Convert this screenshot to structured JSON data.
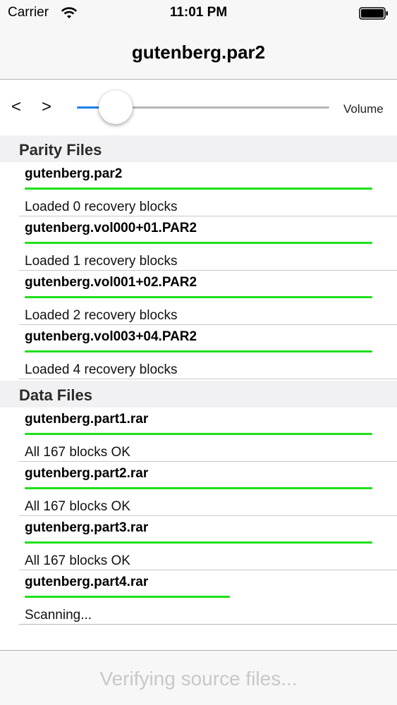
{
  "status_bar": {
    "carrier": "Carrier",
    "time": "11:01 PM",
    "battery_level": 1.0
  },
  "nav": {
    "title": "gutenberg.par2"
  },
  "controls": {
    "prev": "<",
    "next": ">",
    "volume_label": "Volume",
    "volume_level": 0.155
  },
  "colors": {
    "progress": "#1fe01a",
    "slider_accent": "#1a82e8"
  },
  "parity": {
    "header": "Parity Files",
    "files": [
      {
        "name": "gutenberg.par2",
        "status": "Loaded 0 recovery blocks",
        "progress": 1.0
      },
      {
        "name": "gutenberg.vol000+01.PAR2",
        "status": "Loaded 1 recovery blocks",
        "progress": 1.0
      },
      {
        "name": "gutenberg.vol001+02.PAR2",
        "status": "Loaded 2 recovery blocks",
        "progress": 1.0
      },
      {
        "name": "gutenberg.vol003+04.PAR2",
        "status": "Loaded 4 recovery blocks",
        "progress": 1.0
      }
    ]
  },
  "data": {
    "header": "Data Files",
    "files": [
      {
        "name": "gutenberg.part1.rar",
        "status": "All 167 blocks OK",
        "progress": 1.0
      },
      {
        "name": "gutenberg.part2.rar",
        "status": "All 167 blocks OK",
        "progress": 1.0
      },
      {
        "name": "gutenberg.part3.rar",
        "status": "All 167 blocks OK",
        "progress": 1.0
      },
      {
        "name": "gutenberg.part4.rar",
        "status": "Scanning...",
        "progress": 0.59
      }
    ]
  },
  "toolbar": {
    "status": "Verifying source files..."
  }
}
